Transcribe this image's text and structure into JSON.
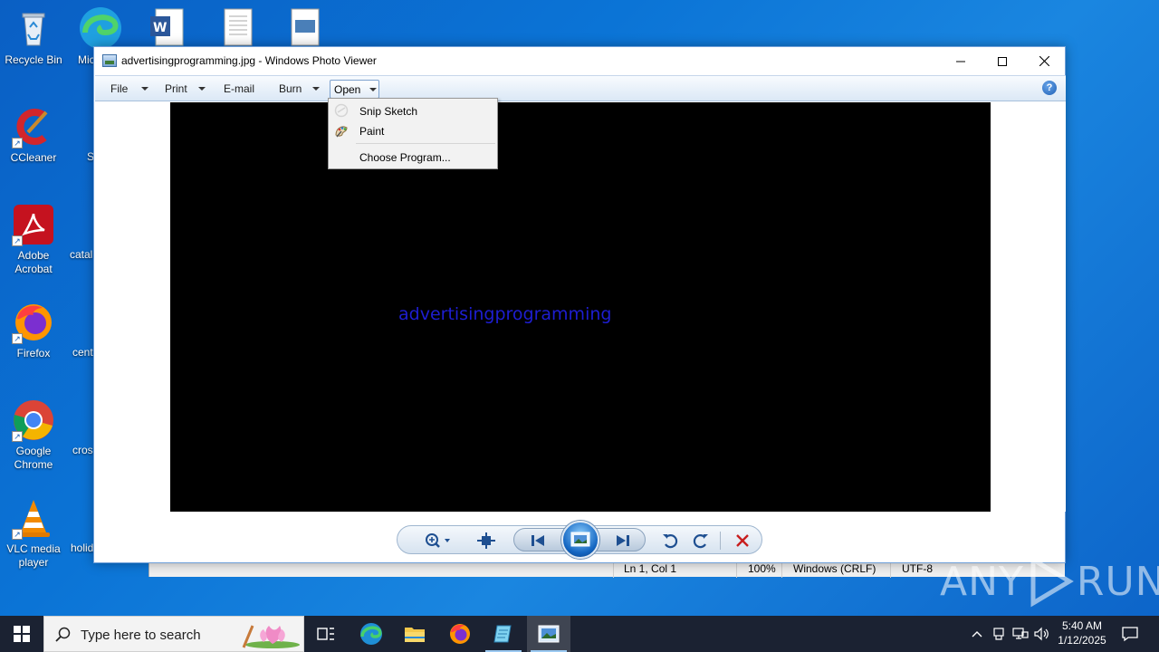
{
  "desktop": {
    "icons": [
      {
        "label": "Recycle Bin"
      },
      {
        "label": "CCleaner"
      },
      {
        "label": "Adobe Acrobat"
      },
      {
        "label": "Firefox"
      },
      {
        "label": "Google Chrome"
      },
      {
        "label": "VLC media player"
      }
    ],
    "partial_labels": [
      "Mic",
      "S",
      "catal",
      "cent",
      "cros",
      "holid"
    ]
  },
  "background_editor_status": {
    "position": "Ln 1, Col 1",
    "zoom": "100%",
    "line_ending": "Windows (CRLF)",
    "encoding": "UTF-8"
  },
  "photo_viewer": {
    "title": "advertisingprogramming.jpg - Windows Photo Viewer",
    "menu": {
      "file": "File",
      "print": "Print",
      "email": "E-mail",
      "burn": "Burn",
      "open": "Open"
    },
    "image_text": "advertisingprogramming",
    "open_menu": {
      "items": [
        {
          "label": "Snip  Sketch",
          "icon": "snip-sketch-icon"
        },
        {
          "label": "Paint",
          "icon": "paint-icon"
        },
        {
          "label": "Choose Program..."
        }
      ]
    }
  },
  "watermark": {
    "left": "ANY",
    "right": "RUN"
  },
  "taskbar": {
    "search_placeholder": "Type here to search",
    "clock_time": "5:40 AM",
    "clock_date": "1/12/2025"
  }
}
